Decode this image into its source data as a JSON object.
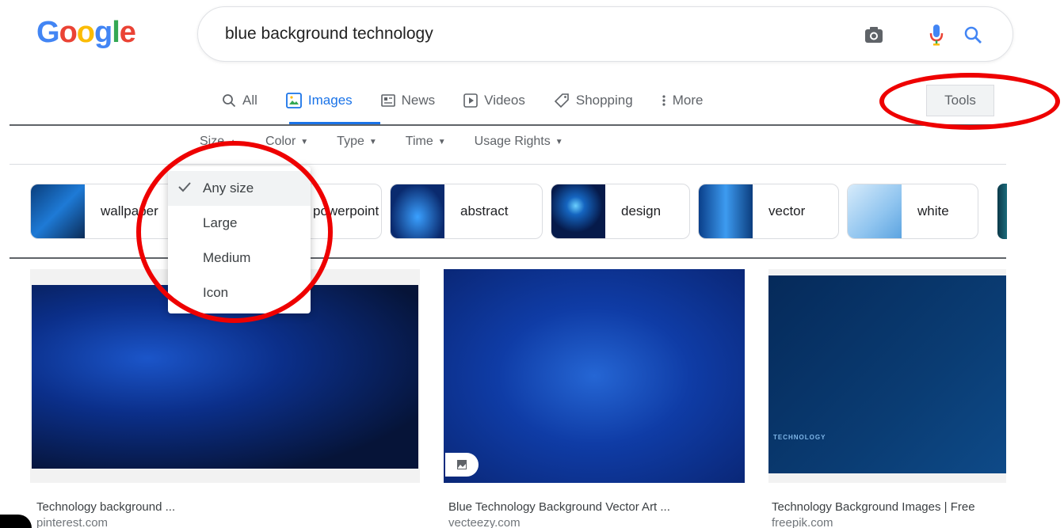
{
  "logo": {
    "text": "Google"
  },
  "search": {
    "query": "blue background technology"
  },
  "tabs": [
    {
      "label": "All",
      "icon": "search-icon"
    },
    {
      "label": "Images",
      "icon": "image-icon"
    },
    {
      "label": "News",
      "icon": "news-icon"
    },
    {
      "label": "Videos",
      "icon": "play-icon"
    },
    {
      "label": "Shopping",
      "icon": "tag-icon"
    },
    {
      "label": "More",
      "icon": "more-vert-icon"
    }
  ],
  "tools": {
    "label": "Tools"
  },
  "filters": [
    {
      "label": "Size",
      "arrow": "▲"
    },
    {
      "label": "Color",
      "arrow": "▼"
    },
    {
      "label": "Type",
      "arrow": "▼"
    },
    {
      "label": "Time",
      "arrow": "▼"
    },
    {
      "label": "Usage Rights",
      "arrow": "▼"
    }
  ],
  "size_menu": {
    "items": [
      "Any size",
      "Large",
      "Medium",
      "Icon"
    ],
    "selected": "Any size"
  },
  "chips": [
    {
      "label": "wallpaper"
    },
    {
      "label": "powerpoint"
    },
    {
      "label": "abstract"
    },
    {
      "label": "design"
    },
    {
      "label": "vector"
    },
    {
      "label": "white"
    }
  ],
  "results": [
    {
      "title": "Technology background ...",
      "source": "pinterest.com"
    },
    {
      "title": "Blue Technology Background Vector Art ...",
      "source": "vecteezy.com"
    },
    {
      "title": "Technology Background Images | Free",
      "source": "freepik.com",
      "overlay": "TECHNOLOGY"
    }
  ],
  "colors": {
    "accent": "#1a73e8",
    "annotation": "#e00000"
  }
}
